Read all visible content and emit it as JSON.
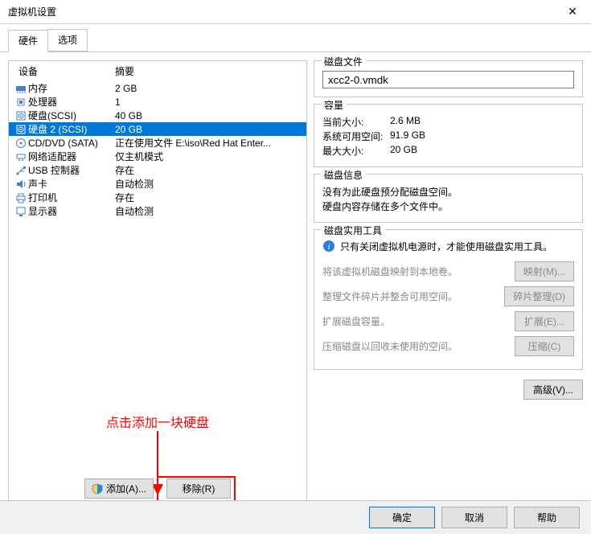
{
  "window": {
    "title": "虚拟机设置",
    "close": "✕"
  },
  "tabs": {
    "hardware": "硬件",
    "options": "选项"
  },
  "hw_header": {
    "device": "设备",
    "summary": "摘要"
  },
  "devices": [
    {
      "icon": "memory",
      "name": "内存",
      "summary": "2 GB"
    },
    {
      "icon": "cpu",
      "name": "处理器",
      "summary": "1"
    },
    {
      "icon": "disk",
      "name": "硬盘(SCSI)",
      "summary": "40 GB"
    },
    {
      "icon": "disk",
      "name": "硬盘 2 (SCSI)",
      "summary": "20 GB",
      "selected": true
    },
    {
      "icon": "cd",
      "name": "CD/DVD (SATA)",
      "summary": "正在使用文件 E:\\iso\\Red Hat Enter..."
    },
    {
      "icon": "net",
      "name": "网络适配器",
      "summary": "仅主机模式"
    },
    {
      "icon": "usb",
      "name": "USB 控制器",
      "summary": "存在"
    },
    {
      "icon": "sound",
      "name": "声卡",
      "summary": "自动检测"
    },
    {
      "icon": "printer",
      "name": "打印机",
      "summary": "存在"
    },
    {
      "icon": "display",
      "name": "显示器",
      "summary": "自动检测"
    }
  ],
  "annotation": "点击添加一块硬盘",
  "bottom_buttons": {
    "add": "添加(A)...",
    "remove": "移除(R)"
  },
  "groups": {
    "diskfile": {
      "legend": "磁盘文件",
      "value": "xcc2-0.vmdk"
    },
    "capacity": {
      "legend": "容量",
      "current_label": "当前大小:",
      "current_value": "2.6 MB",
      "free_label": "系统可用空间:",
      "free_value": "91.9 GB",
      "max_label": "最大大小:",
      "max_value": "20 GB"
    },
    "diskinfo": {
      "legend": "磁盘信息",
      "line1": "没有为此硬盘预分配磁盘空间。",
      "line2": "硬盘内容存储在多个文件中。"
    },
    "tools": {
      "legend": "磁盘实用工具",
      "tip": "只有关闭虚拟机电源时，才能使用磁盘实用工具。",
      "map_label": "将该虚拟机磁盘映射到本地卷。",
      "map_btn": "映射(M)...",
      "defrag_label": "整理文件碎片并整合可用空间。",
      "defrag_btn": "碎片整理(D)",
      "expand_label": "扩展磁盘容量。",
      "expand_btn": "扩展(E)...",
      "compact_label": "压缩磁盘以回收未使用的空间。",
      "compact_btn": "压缩(C)"
    },
    "advanced_btn": "高级(V)..."
  },
  "footer": {
    "ok": "确定",
    "cancel": "取消",
    "help": "帮助"
  }
}
